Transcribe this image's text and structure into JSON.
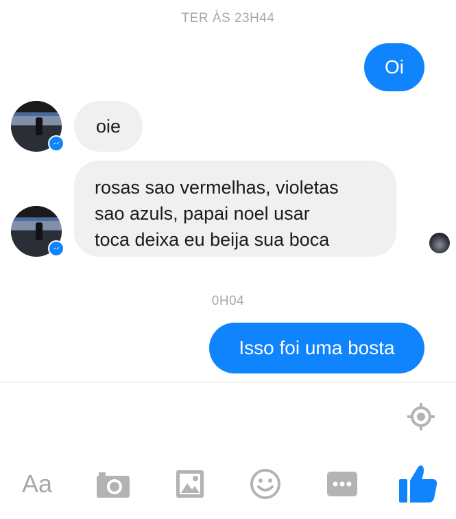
{
  "conversation": {
    "timestamps": [
      "TER ÀS 23H44",
      "0H04"
    ],
    "messages": {
      "oi": "Oi",
      "oie": "oie",
      "rosas_lines": [
        "rosas sao vermelhas, violetas",
        "sao azuls, papai noel usar",
        "toca deixa eu beija sua boca"
      ],
      "isso": "Isso foi uma bosta"
    }
  },
  "composer": {
    "text_button_label": "Aa",
    "icons": [
      "location-icon",
      "camera-icon",
      "image-icon",
      "emoji-icon",
      "more-icon",
      "like-icon"
    ]
  },
  "colors": {
    "outgoing_bubble": "#0f84fc",
    "incoming_bubble": "#f0f0f0",
    "timestamp_text": "#a8a8a8",
    "icon_gray": "#b3b3b3"
  }
}
